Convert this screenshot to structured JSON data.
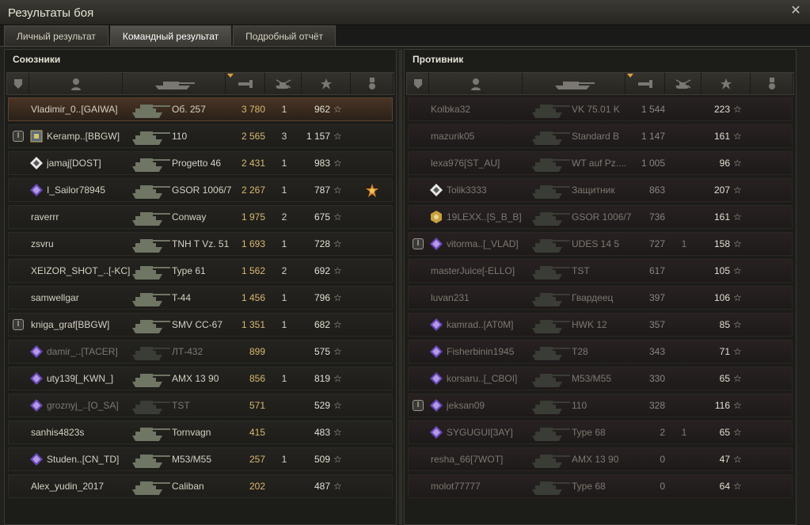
{
  "window": {
    "title": "Результаты боя"
  },
  "tabs": [
    {
      "label": "Личный результат",
      "active": false
    },
    {
      "label": "Командный результат",
      "active": true
    },
    {
      "label": "Подробный отчёт",
      "active": false
    }
  ],
  "allies": {
    "title": "Союзники",
    "rows": [
      {
        "name": "Vladimir_0..[GAIWA]",
        "vehicle": "Об. 257",
        "damage": "3 780",
        "kills": "1",
        "xp": "962",
        "platoon": "",
        "badge": "",
        "me": true,
        "dead": false,
        "medal": ""
      },
      {
        "name": "Keramp..[BBGW]",
        "vehicle": "110",
        "damage": "2 565",
        "kills": "3",
        "xp": "1 157",
        "platoon": "I",
        "badge": "clan",
        "me": false,
        "dead": false,
        "medal": ""
      },
      {
        "name": "jamaj[DOST]",
        "vehicle": "Progetto 46",
        "damage": "2 431",
        "kills": "1",
        "xp": "983",
        "platoon": "",
        "badge": "white",
        "me": false,
        "dead": false,
        "medal": ""
      },
      {
        "name": "I_Sailor78945",
        "vehicle": "GSOR 1006/7",
        "damage": "2 267",
        "kills": "1",
        "xp": "787",
        "platoon": "",
        "badge": "purple",
        "me": false,
        "dead": false,
        "medal": "star-medal"
      },
      {
        "name": "raverrr",
        "vehicle": "Conway",
        "damage": "1 975",
        "kills": "2",
        "xp": "675",
        "platoon": "",
        "badge": "",
        "me": false,
        "dead": false,
        "medal": ""
      },
      {
        "name": "zsvru",
        "vehicle": "TNH T Vz. 51",
        "damage": "1 693",
        "kills": "1",
        "xp": "728",
        "platoon": "",
        "badge": "",
        "me": false,
        "dead": false,
        "medal": ""
      },
      {
        "name": "XEIZOR_SHOT_..[-KC]",
        "vehicle": "Type 61",
        "damage": "1 562",
        "kills": "2",
        "xp": "692",
        "platoon": "",
        "badge": "",
        "me": false,
        "dead": false,
        "medal": ""
      },
      {
        "name": "samwellgar",
        "vehicle": "T-44",
        "damage": "1 456",
        "kills": "1",
        "xp": "796",
        "platoon": "",
        "badge": "",
        "me": false,
        "dead": false,
        "medal": ""
      },
      {
        "name": "kniga_graf[BBGW]",
        "vehicle": "SMV CC-67",
        "damage": "1 351",
        "kills": "1",
        "xp": "682",
        "platoon": "I",
        "badge": "",
        "me": false,
        "dead": false,
        "medal": ""
      },
      {
        "name": "damir_..[TACER]",
        "vehicle": "ЛТ-432",
        "damage": "899",
        "kills": "",
        "xp": "575",
        "platoon": "",
        "badge": "purple",
        "me": false,
        "dead": true,
        "medal": ""
      },
      {
        "name": "uty139[_KWN_]",
        "vehicle": "AMX 13 90",
        "damage": "856",
        "kills": "1",
        "xp": "819",
        "platoon": "",
        "badge": "purple",
        "me": false,
        "dead": false,
        "medal": ""
      },
      {
        "name": "groznyj_..[O_SA]",
        "vehicle": "TST",
        "damage": "571",
        "kills": "",
        "xp": "529",
        "platoon": "",
        "badge": "purple",
        "me": false,
        "dead": true,
        "medal": ""
      },
      {
        "name": "sanhis4823s",
        "vehicle": "Tornvagn",
        "damage": "415",
        "kills": "",
        "xp": "483",
        "platoon": "",
        "badge": "",
        "me": false,
        "dead": false,
        "medal": ""
      },
      {
        "name": "Studen..[CN_TD]",
        "vehicle": "M53/M55",
        "damage": "257",
        "kills": "1",
        "xp": "509",
        "platoon": "",
        "badge": "purple",
        "me": false,
        "dead": false,
        "medal": ""
      },
      {
        "name": "Alex_yudin_2017",
        "vehicle": "Caliban",
        "damage": "202",
        "kills": "",
        "xp": "487",
        "platoon": "",
        "badge": "",
        "me": false,
        "dead": false,
        "medal": ""
      }
    ]
  },
  "enemies": {
    "title": "Противник",
    "rows": [
      {
        "name": "Kolbka32",
        "vehicle": "VK 75.01 K",
        "damage": "1 544",
        "kills": "",
        "xp": "223",
        "platoon": "",
        "badge": "",
        "dead": true
      },
      {
        "name": "mazurik05",
        "vehicle": "Standard B",
        "damage": "1 147",
        "kills": "",
        "xp": "161",
        "platoon": "",
        "badge": "",
        "dead": true
      },
      {
        "name": "lexa976[ST_AU]",
        "vehicle": "WT auf Pz....",
        "damage": "1 005",
        "kills": "",
        "xp": "96",
        "platoon": "",
        "badge": "",
        "dead": true
      },
      {
        "name": "Tolik3333",
        "vehicle": "Защитник",
        "damage": "863",
        "kills": "",
        "xp": "207",
        "platoon": "",
        "badge": "white",
        "dead": true
      },
      {
        "name": "19LEXX..[S_B_B]",
        "vehicle": "GSOR 1006/7",
        "damage": "736",
        "kills": "",
        "xp": "161",
        "platoon": "",
        "badge": "gold",
        "dead": true
      },
      {
        "name": "vitorma..[_VLAD]",
        "vehicle": "UDES 14 5",
        "damage": "727",
        "kills": "1",
        "xp": "158",
        "platoon": "I",
        "badge": "purple",
        "dead": true
      },
      {
        "name": "masterJuice[-ELLO]",
        "vehicle": "TST",
        "damage": "617",
        "kills": "",
        "xp": "105",
        "platoon": "",
        "badge": "",
        "dead": true
      },
      {
        "name": "luvan231",
        "vehicle": "Гвардеец",
        "damage": "397",
        "kills": "",
        "xp": "106",
        "platoon": "",
        "badge": "",
        "dead": true
      },
      {
        "name": "kamrad..[AT0M]",
        "vehicle": "HWK 12",
        "damage": "357",
        "kills": "",
        "xp": "85",
        "platoon": "",
        "badge": "purple",
        "dead": true
      },
      {
        "name": "Fisherbinin1945",
        "vehicle": "T28",
        "damage": "343",
        "kills": "",
        "xp": "71",
        "platoon": "",
        "badge": "purple",
        "dead": true
      },
      {
        "name": "korsaru..[_CBOI]",
        "vehicle": "M53/M55",
        "damage": "330",
        "kills": "",
        "xp": "65",
        "platoon": "",
        "badge": "purple",
        "dead": true
      },
      {
        "name": "jeksan09",
        "vehicle": "110",
        "damage": "328",
        "kills": "",
        "xp": "116",
        "platoon": "I",
        "badge": "purple",
        "dead": true
      },
      {
        "name": "SYGUGUI[3AY]",
        "vehicle": "Type 68",
        "damage": "2",
        "kills": "1",
        "xp": "65",
        "platoon": "",
        "badge": "purple",
        "dead": true
      },
      {
        "name": "resha_66[7WOT]",
        "vehicle": "AMX 13 90",
        "damage": "0",
        "kills": "",
        "xp": "47",
        "platoon": "",
        "badge": "",
        "dead": true
      },
      {
        "name": "molot77777",
        "vehicle": "Type 68",
        "damage": "0",
        "kills": "",
        "xp": "64",
        "platoon": "",
        "badge": "",
        "dead": true
      }
    ]
  },
  "xp_star": "☆",
  "colors": {
    "damage_ally": "#d9b870",
    "highlight_row": "#4a3425"
  }
}
